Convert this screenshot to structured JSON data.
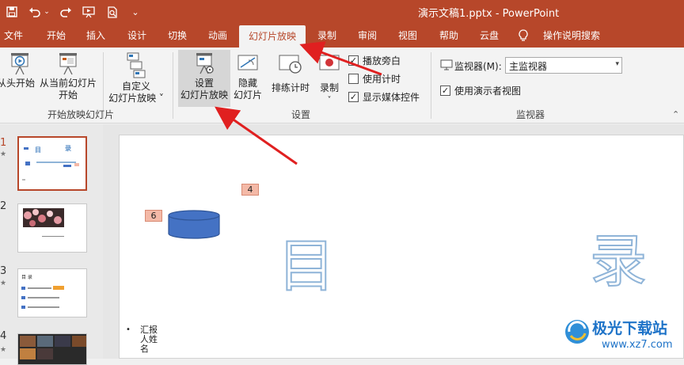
{
  "title_bar": {
    "document_title": "演示文稿1.pptx  -  PowerPoint"
  },
  "qat_icons": [
    "save-icon",
    "undo-icon",
    "undo-dropdown-icon",
    "redo-icon",
    "start-slideshow-icon",
    "print-preview-icon",
    "customize-qat-icon"
  ],
  "tabs": [
    {
      "label": "文件"
    },
    {
      "label": "开始"
    },
    {
      "label": "插入"
    },
    {
      "label": "设计"
    },
    {
      "label": "切换"
    },
    {
      "label": "动画"
    },
    {
      "label": "幻灯片放映",
      "active": true
    },
    {
      "label": "录制"
    },
    {
      "label": "审阅"
    },
    {
      "label": "视图"
    },
    {
      "label": "帮助"
    },
    {
      "label": "云盘"
    },
    {
      "label": "操作说明搜索"
    }
  ],
  "ribbon": {
    "start_group": {
      "label": "开始放映幻灯片",
      "from_beginning": "从头开始",
      "from_current_line1": "从当前幻灯片",
      "from_current_line2": "开始",
      "custom_line1": "自定义",
      "custom_line2": "幻灯片放映 ˅"
    },
    "setup_group": {
      "label": "设置",
      "setup_line1": "设置",
      "setup_line2": "幻灯片放映",
      "hide_line1": "隐藏",
      "hide_line2": "幻灯片",
      "rehearse": "排练计时",
      "record": "录制",
      "record_arrow": "˅",
      "chk_narration": "播放旁白",
      "chk_timings": "使用计时",
      "chk_media": "显示媒体控件"
    },
    "monitor_group": {
      "label": "监视器",
      "monitor_label": "监视器(M):",
      "monitor_value": "主监视器",
      "presenter_view": "使用演示者视图"
    }
  },
  "checkbox_states": {
    "narration": true,
    "timings": false,
    "media": true,
    "presenter_view": true
  },
  "thumbnails": [
    {
      "num": "1",
      "active": true
    },
    {
      "num": "2"
    },
    {
      "num": "3"
    },
    {
      "num": "4"
    }
  ],
  "slide": {
    "tag_4": "4",
    "tag_6": "6",
    "char_mu": "目",
    "char_lu": "录",
    "bullet": "•",
    "body_line1": "汇报",
    "body_line2": "人姓",
    "body_line3": "名"
  },
  "thumb_text": {
    "t1_mu": "目",
    "t1_lu": "录",
    "t3_title": "目 录"
  },
  "colors": {
    "brand": "#b7472a",
    "ribbon_bg": "#f3f3f3",
    "tag_fill": "#f4b9a7",
    "cylinder": "#4472c4",
    "outline_text": "#8fb4d8",
    "arrow": "#e02020"
  },
  "watermark": {
    "brand_name": "极光下载站",
    "url": "www.xz7.com"
  }
}
